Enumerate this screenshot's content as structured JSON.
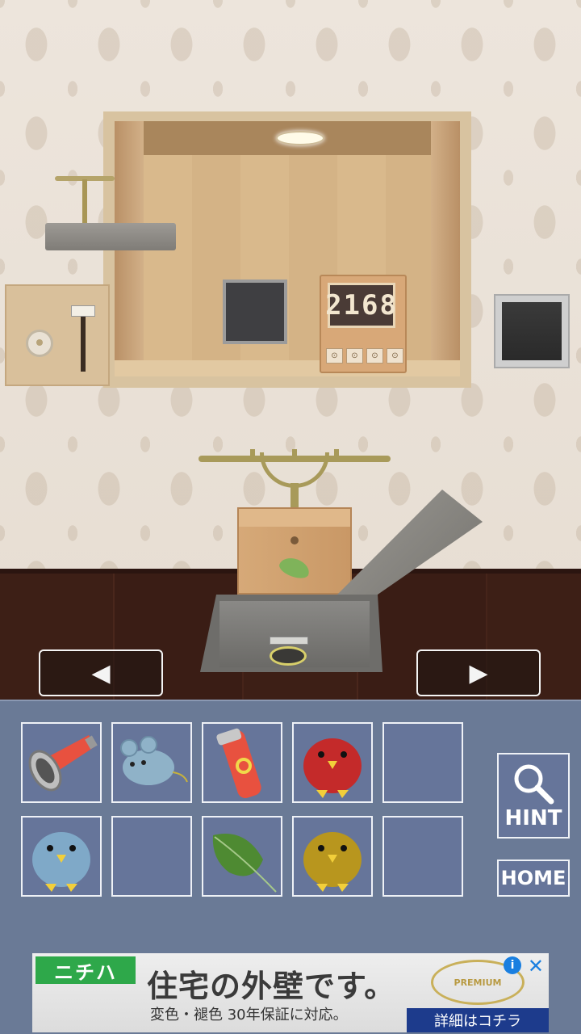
{
  "scene": {
    "counter_display": "2168",
    "counter_buttons": [
      "⊙",
      "⊙",
      "⊙",
      "⊙"
    ]
  },
  "navigation": {
    "left_arrow": "◀",
    "right_arrow": "▶"
  },
  "inventory": {
    "slots": [
      {
        "item": "red-megaphone"
      },
      {
        "item": "blue-mouse-toy"
      },
      {
        "item": "red-flashlight"
      },
      {
        "item": "red-knit-bird"
      },
      {
        "item": "empty"
      },
      {
        "item": "blue-knit-bird"
      },
      {
        "item": "empty"
      },
      {
        "item": "green-leaf"
      },
      {
        "item": "yellow-knit-bird"
      },
      {
        "item": "empty"
      }
    ],
    "hint_label": "HINT",
    "home_label": "HOME"
  },
  "ad": {
    "brand": "ニチハ",
    "headline": "住宅の外壁です。",
    "subtext": "変色・褪色 30年保証に対応。",
    "cta": "詳細はコチラ",
    "logo_text": "PREMIUM",
    "info_icon": "i",
    "close_icon": "✕"
  }
}
